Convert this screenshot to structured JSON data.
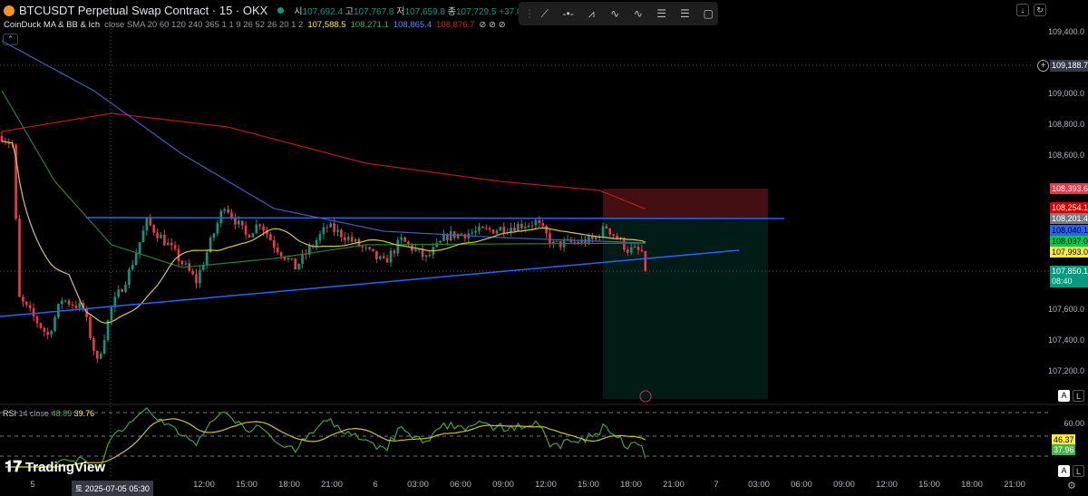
{
  "header": {
    "symbol": "BTCUSDT Perpetual Swap Contract · 15 · OKX",
    "o_label": "시",
    "o": "107,692.4",
    "h_label": "고",
    "h": "107,767.8",
    "l_label": "저",
    "l": "107,659.8",
    "c_label": "종",
    "c": "107,729.5",
    "change": "+37.0 (+0.03%)"
  },
  "indicator": {
    "name": "CoinDuck MA & BB & Ich",
    "params": "close SMA 20 60 120 240 365 1 1 9 26 52 26 20 1 2",
    "v1": "107,588.5",
    "v2": "108,271.1",
    "v3": "108,865.4",
    "v4": "108,876.7",
    "icons": "⊘ ⊘ ⊘"
  },
  "price_axis": [
    "109,400.0",
    "109,000.0",
    "108,800.0",
    "108,600.0",
    "107,600.0",
    "107,400.0",
    "107,200.0"
  ],
  "price_tags": [
    {
      "v": "109,188.7",
      "c": "#363a45"
    },
    {
      "v": "108,393.6",
      "c": "#f23645"
    },
    {
      "v": "108,254.1",
      "c": "#d50000"
    },
    {
      "v": "108,201.4",
      "c": "#787b86"
    },
    {
      "v": "108,040.1",
      "c": "#2962ff"
    },
    {
      "v": "108,037.0",
      "c": "#00c853"
    },
    {
      "v": "107,993.0",
      "c": "#ffeb3b"
    }
  ],
  "last_price": {
    "v": "107,850.1",
    "countdown": "08:40"
  },
  "time_axis": [
    "5",
    "09:00",
    "12:00",
    "15:00",
    "18:00",
    "21:00",
    "6",
    "03:00",
    "06:00",
    "09:00",
    "12:00",
    "15:00",
    "18:00",
    "21:00",
    "7",
    "03:00",
    "06:00",
    "09:00",
    "12:00",
    "15:00",
    "18:00",
    "21:00"
  ],
  "crosshair_time": "토 2025-07-05  05:30",
  "rsi": {
    "label": "RSI",
    "params": "14 close",
    "v1": "48.89",
    "v2": "39.76",
    "axis": "60.00",
    "tag1": "46.37",
    "tag2": "37.96"
  },
  "brand": "TradingView",
  "buttons": {
    "auto": "A",
    "log": "L"
  },
  "price_path": [
    [
      0,
      108724
    ],
    [
      3,
      108665
    ],
    [
      5,
      107665
    ],
    [
      13,
      107430
    ],
    [
      17,
      107665
    ],
    [
      23,
      107606
    ],
    [
      27,
      107253
    ],
    [
      31,
      107606
    ],
    [
      36,
      107841
    ],
    [
      41,
      108165
    ],
    [
      47,
      108018
    ],
    [
      55,
      107782
    ],
    [
      63,
      108282
    ],
    [
      69,
      108076
    ],
    [
      73,
      108165
    ],
    [
      77,
      108018
    ],
    [
      83,
      107871
    ],
    [
      92,
      108135
    ],
    [
      97,
      108076
    ],
    [
      108,
      107900
    ],
    [
      113,
      108047
    ],
    [
      120,
      107929
    ],
    [
      126,
      108076
    ],
    [
      136,
      108106
    ],
    [
      144,
      108135
    ],
    [
      151,
      108165
    ],
    [
      156,
      108018
    ],
    [
      167,
      108047
    ],
    [
      171,
      108135
    ],
    [
      177,
      107988
    ],
    [
      181,
      107971
    ],
    [
      182,
      107812
    ],
    [
      183,
      107840
    ]
  ],
  "ma_red": [
    [
      0,
      108753
    ],
    [
      31,
      108871
    ],
    [
      64,
      108782
    ],
    [
      103,
      108547
    ],
    [
      141,
      108429
    ],
    [
      169,
      108371
    ],
    [
      183,
      108241
    ]
  ],
  "ma_blue": [
    [
      0,
      109341
    ],
    [
      26,
      109018
    ],
    [
      51,
      108606
    ],
    [
      77,
      108253
    ],
    [
      108,
      108106
    ],
    [
      141,
      108065
    ],
    [
      183,
      108029
    ]
  ],
  "ma_green": [
    [
      0,
      109018
    ],
    [
      15,
      108429
    ],
    [
      31,
      108018
    ],
    [
      51,
      107871
    ],
    [
      77,
      107929
    ],
    [
      103,
      108018
    ],
    [
      183,
      108029
    ]
  ]
}
